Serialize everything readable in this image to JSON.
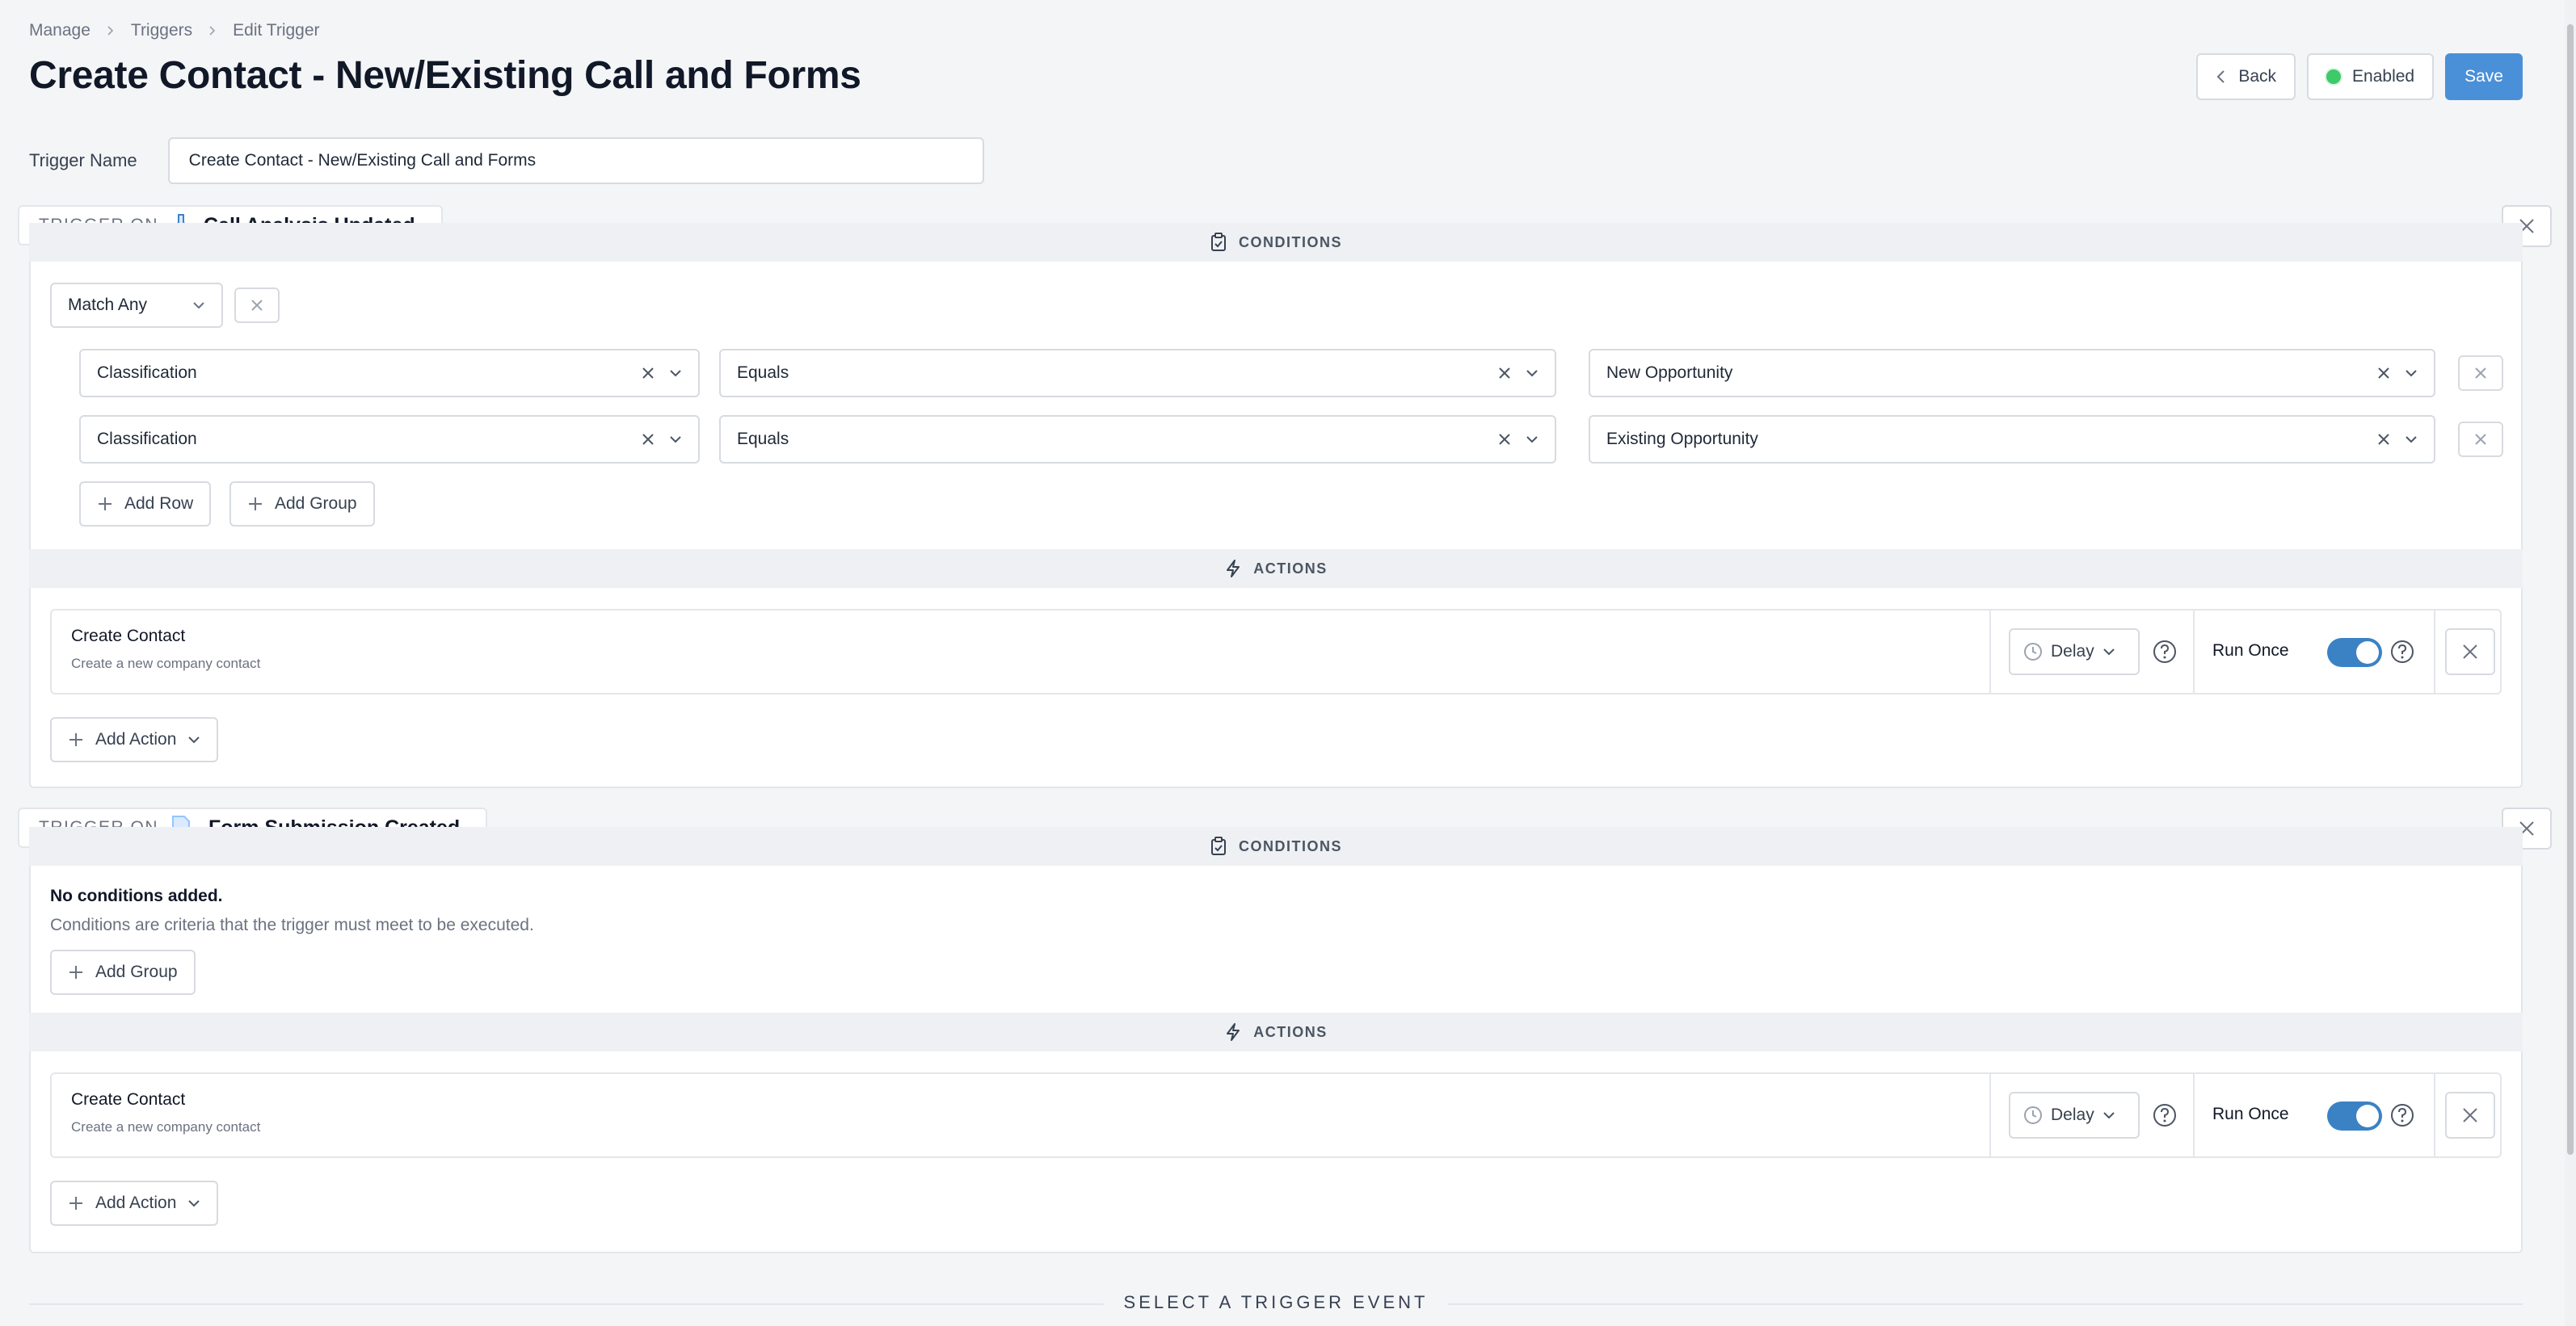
{
  "breadcrumb": [
    "Manage",
    "Triggers",
    "Edit Trigger"
  ],
  "page_title": "Create Contact - New/Existing Call and Forms",
  "header_actions": {
    "back": "Back",
    "status": "Enabled",
    "save": "Save"
  },
  "trigger_name": {
    "label": "Trigger Name",
    "value": "Create Contact - New/Existing Call and Forms"
  },
  "triggers": [
    {
      "keyword": "TRIGGER ON",
      "event": "Call Analysis Updated",
      "event_icon": "flask-icon",
      "conditions_header": "CONDITIONS",
      "match": "Match Any",
      "rows": [
        {
          "field": "Classification",
          "operator": "Equals",
          "value": "New Opportunity"
        },
        {
          "field": "Classification",
          "operator": "Equals",
          "value": "Existing Opportunity"
        }
      ],
      "add_row": "Add Row",
      "add_group": "Add Group",
      "actions_header": "ACTIONS",
      "action": {
        "title": "Create Contact",
        "subtitle": "Create a new company contact",
        "delay": "Delay",
        "run_once": "Run Once",
        "run_once_on": true
      },
      "add_action": "Add Action"
    },
    {
      "keyword": "TRIGGER ON",
      "event": "Form Submission Created",
      "event_icon": "form-plus-icon",
      "conditions_header": "CONDITIONS",
      "empty_title": "No conditions added.",
      "empty_text": "Conditions are criteria that the trigger must meet to be executed.",
      "add_group": "Add Group",
      "actions_header": "ACTIONS",
      "action": {
        "title": "Create Contact",
        "subtitle": "Create a new company contact",
        "delay": "Delay",
        "run_once": "Run Once",
        "run_once_on": true
      },
      "add_action": "Add Action"
    }
  ],
  "select_event_label": "SELECT A TRIGGER EVENT",
  "colors": {
    "primary": "#4a90d9",
    "toggle": "#3b82c4",
    "enabled_dot": "#3ec96a",
    "background": "#f4f5f7"
  }
}
